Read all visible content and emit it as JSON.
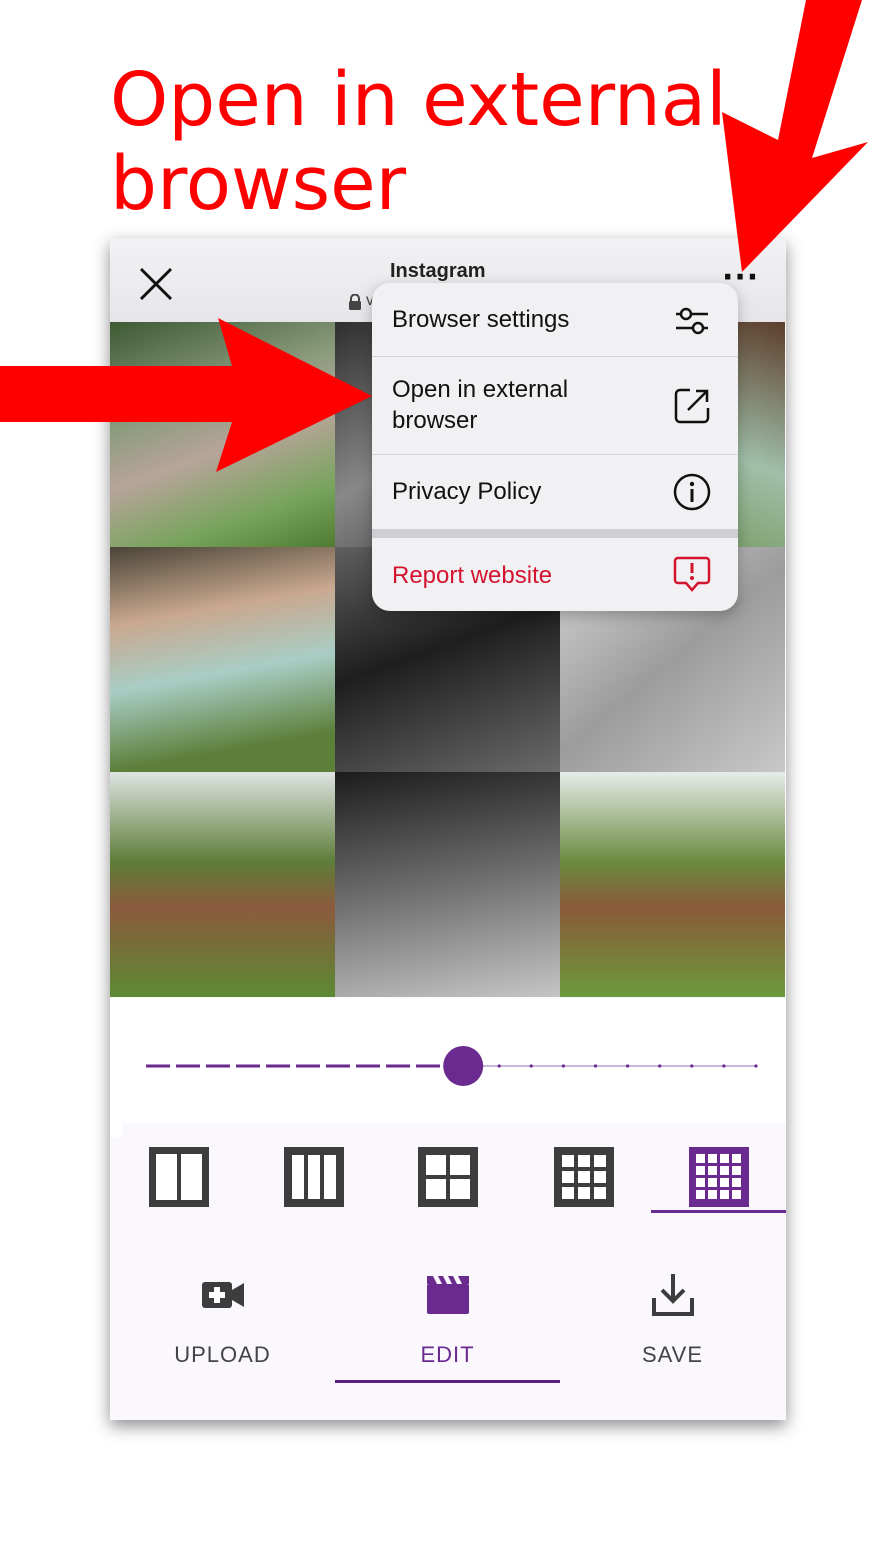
{
  "annotation": {
    "callout": "Open in external browser",
    "color": "#ff0000"
  },
  "browser": {
    "site_title": "Instagram",
    "url_fragment": "v",
    "icons": {
      "close": "close-icon",
      "lock": "lock-icon",
      "more": "more-icon"
    }
  },
  "menu": {
    "items": [
      {
        "label": "Browser settings",
        "icon": "sliders-icon"
      },
      {
        "label": "Open in external browser",
        "icon": "external-link-icon"
      },
      {
        "label": "Privacy Policy",
        "icon": "info-icon"
      },
      {
        "label": "Report website",
        "icon": "report-icon",
        "color": "#d4132f"
      }
    ]
  },
  "editor": {
    "slider_value": 0.52,
    "accent": "#6a2a8f",
    "layouts": [
      {
        "name": "layout-2-columns",
        "selected": false
      },
      {
        "name": "layout-3-columns",
        "selected": false
      },
      {
        "name": "layout-2x2-grid",
        "selected": false
      },
      {
        "name": "layout-3x3-grid",
        "selected": false
      },
      {
        "name": "layout-4x4-grid",
        "selected": true
      }
    ]
  },
  "bottom_nav": {
    "items": [
      {
        "label": "UPLOAD",
        "icon": "video-add-icon",
        "active": false
      },
      {
        "label": "EDIT",
        "icon": "clapperboard-icon",
        "active": true
      },
      {
        "label": "SAVE",
        "icon": "download-icon",
        "active": false
      }
    ]
  }
}
